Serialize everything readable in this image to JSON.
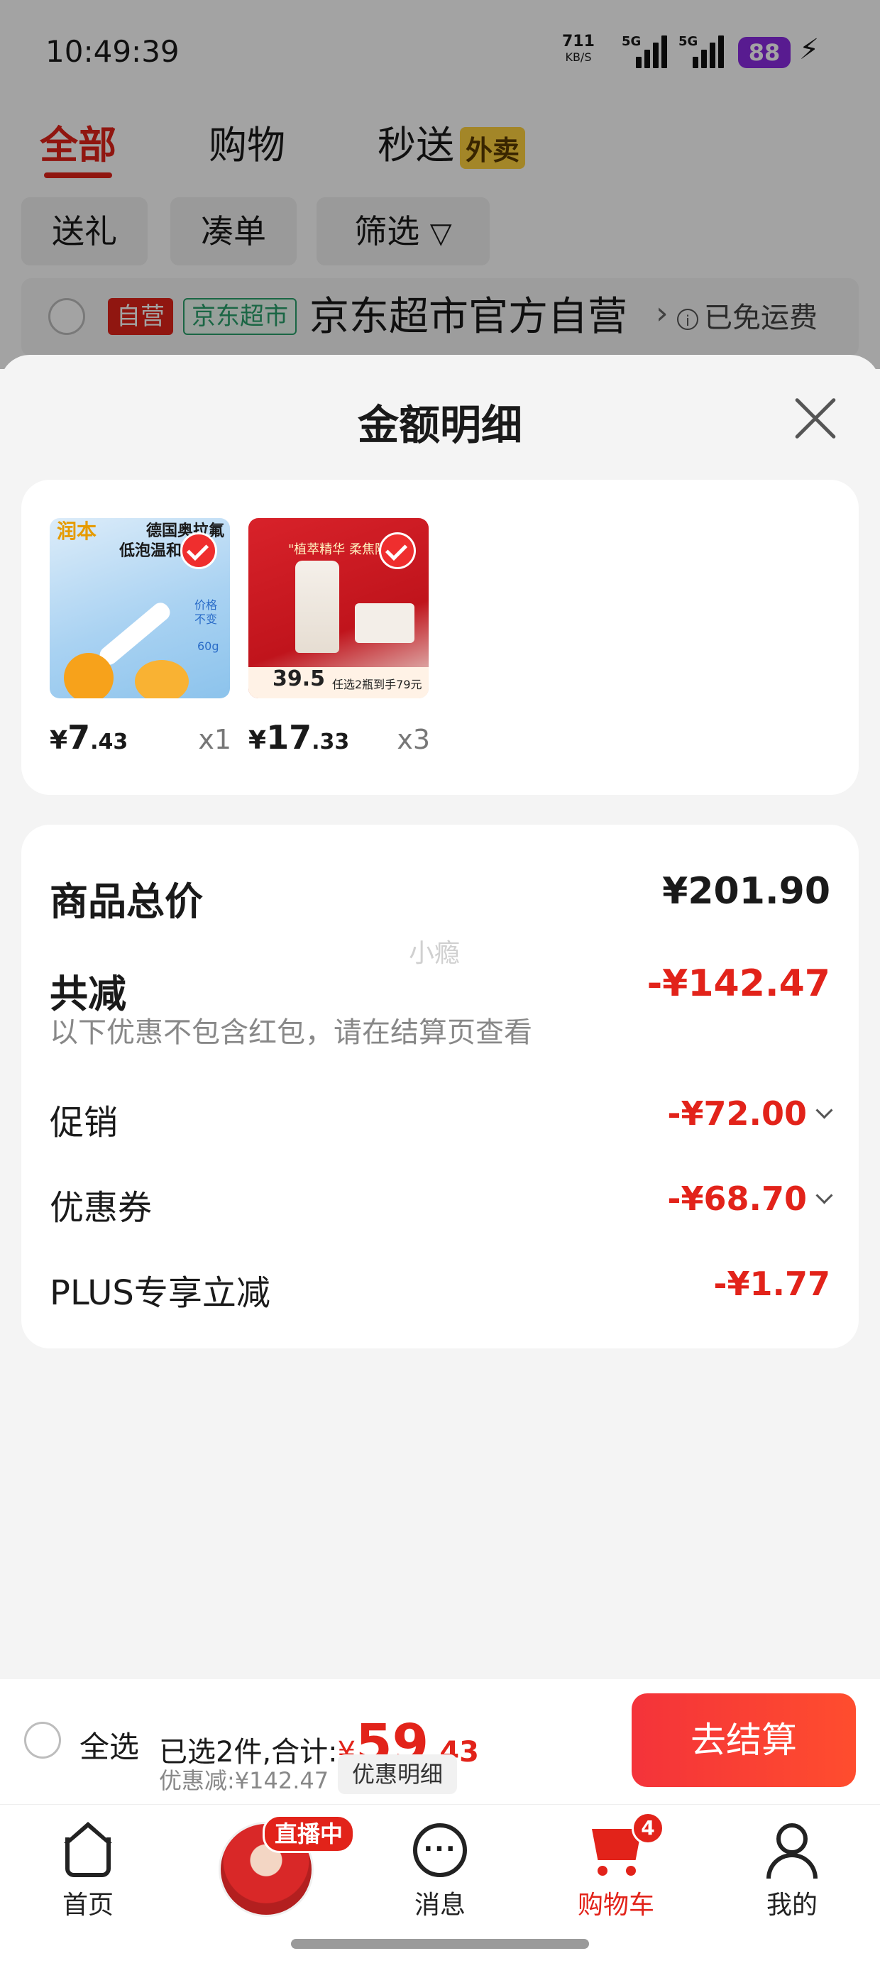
{
  "status_bar": {
    "time": "10:49:39",
    "net_speed": "711",
    "net_unit": "KB/S",
    "sig1_label": "5G",
    "sig2_label": "5G",
    "battery": "88"
  },
  "top_tabs": [
    {
      "label": "全部",
      "active": true
    },
    {
      "label": "购物",
      "active": false
    },
    {
      "label": "秒送",
      "active": false,
      "badge": "外卖"
    }
  ],
  "filter_chips": [
    "送礼",
    "凑单",
    "筛选"
  ],
  "shop": {
    "tag_self": "自营",
    "tag_market": "京东超市",
    "name": "京东超市官方自营",
    "shipping": "已免运费"
  },
  "sheet": {
    "title": "金额明细",
    "products": [
      {
        "price_yen": "¥",
        "price_int": "7",
        "price_dec": ".43",
        "qty": "x1",
        "img_text": [
          "润本",
          "德国奥拉氟",
          "低泡温和",
          "价格",
          "不变",
          "60g"
        ]
      },
      {
        "price_yen": "¥",
        "price_int": "17",
        "price_dec": ".33",
        "qty": "x3",
        "img_text": [
          "\"植萃精华 柔焦隐形毛",
          "39.5",
          "任选2瓶到手79元"
        ]
      }
    ],
    "summary": {
      "total_label": "商品总价",
      "total_value": "¥201.90",
      "reduce_label": "共减",
      "reduce_value": "-¥142.47",
      "note": "以下优惠不包含红包，请在结算页查看",
      "rows": [
        {
          "label": "促销",
          "value": "-¥72.00",
          "expandable": true
        },
        {
          "label": "优惠券",
          "value": "-¥68.70",
          "expandable": true
        },
        {
          "label": "PLUS专享立减",
          "value": "-¥1.77",
          "expandable": false
        }
      ],
      "watermark": "小瘾"
    }
  },
  "checkout_bar": {
    "select_all": "全选",
    "selected_text": "已选2件,合计:",
    "total_yen": "¥",
    "total_int": "59",
    "total_dec": ".43",
    "discount_text": "优惠减:¥142.47",
    "detail_button": "优惠明细",
    "checkout_button": "去结算"
  },
  "tabbar": {
    "items": [
      {
        "label": "首页"
      },
      {
        "label": "直播中"
      },
      {
        "label": "消息"
      },
      {
        "label": "购物车",
        "badge": "4",
        "active": true
      },
      {
        "label": "我的"
      }
    ]
  },
  "colors": {
    "accent_red": "#e2231a",
    "market_green": "#2aa06b",
    "battery_purple": "#8a2be2",
    "waimai_yellow": "#ffd23f"
  }
}
